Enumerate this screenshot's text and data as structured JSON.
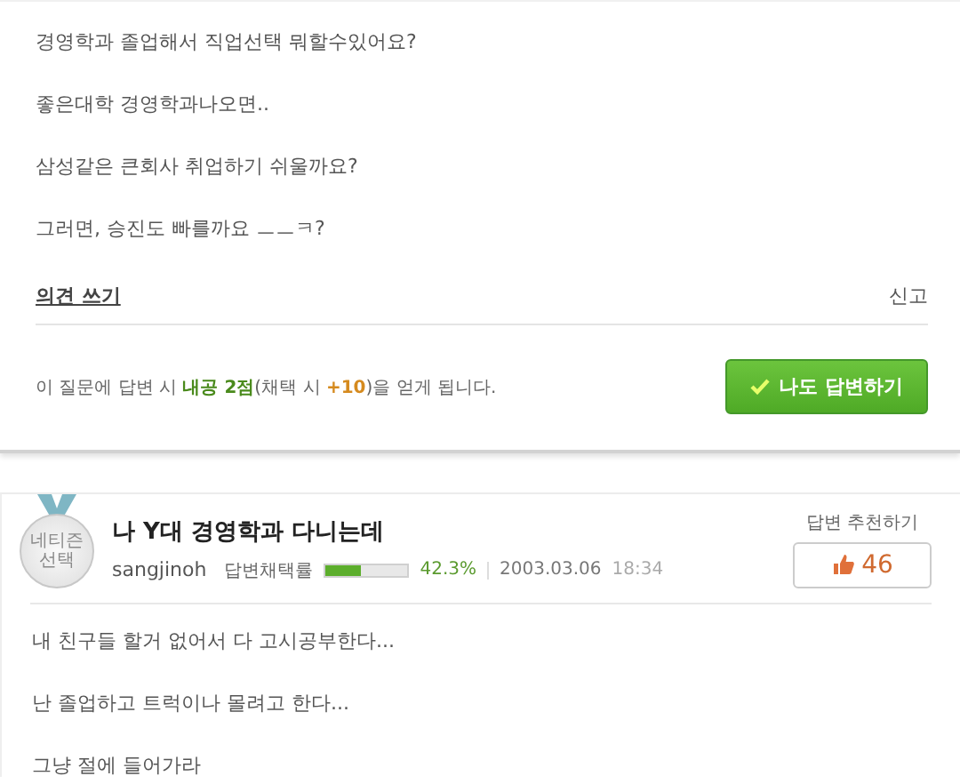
{
  "question": {
    "lines": [
      "경영학과 졸업해서 직업선택 뭐할수있어요?",
      "좋은대학 경영학과나오면..",
      "삼성같은 큰회사 취업하기 쉬울까요?",
      "그러면, 승진도 빠를까요 ㅡㅡㅋ?"
    ],
    "opinion_link": "의견 쓰기",
    "report_link": "신고",
    "reward_text": "이 질문에 답변 시 **내공 2점**(채택 시 **+10**)을 얻게 됩니다.",
    "answer_button": "나도 답변하기"
  },
  "answer": {
    "badge": [
      "네티즌",
      "선택"
    ],
    "title": "나 Y대 경영학과 다니는데",
    "author": "sangjinoh",
    "rate_label": "답변채택률",
    "level": 0.423,
    "rate": "42.3%",
    "date": "2003.03.06",
    "time": "18:34",
    "recommend_label": "답변 추천하기",
    "recommend_count": "46",
    "lines": [
      "내 친구들 할거 없어서 다 고시공부한다...",
      "난 졸업하고 트럭이나 몰려고 한다...",
      "그냥 절에 들어가라"
    ]
  }
}
